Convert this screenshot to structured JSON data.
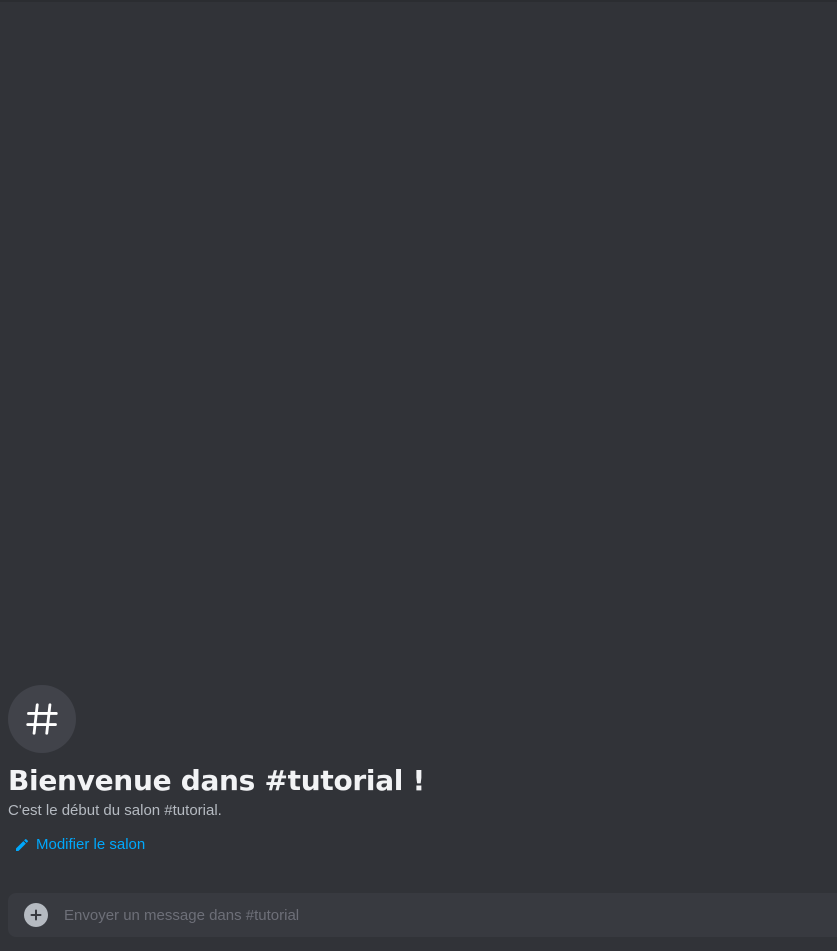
{
  "channel": {
    "welcome_title": "Bienvenue dans #tutorial !",
    "welcome_subtitle": "C'est le début du salon #tutorial.",
    "edit_label": "Modifier le salon",
    "icon": "hash-icon"
  },
  "composer": {
    "placeholder": "Envoyer un message dans #tutorial",
    "value": "",
    "attach_icon": "plus-circle-icon"
  },
  "colors": {
    "background": "#313338",
    "avatar_bg": "#41434a",
    "link": "#00a8fc",
    "composer_bg": "#383a40"
  }
}
